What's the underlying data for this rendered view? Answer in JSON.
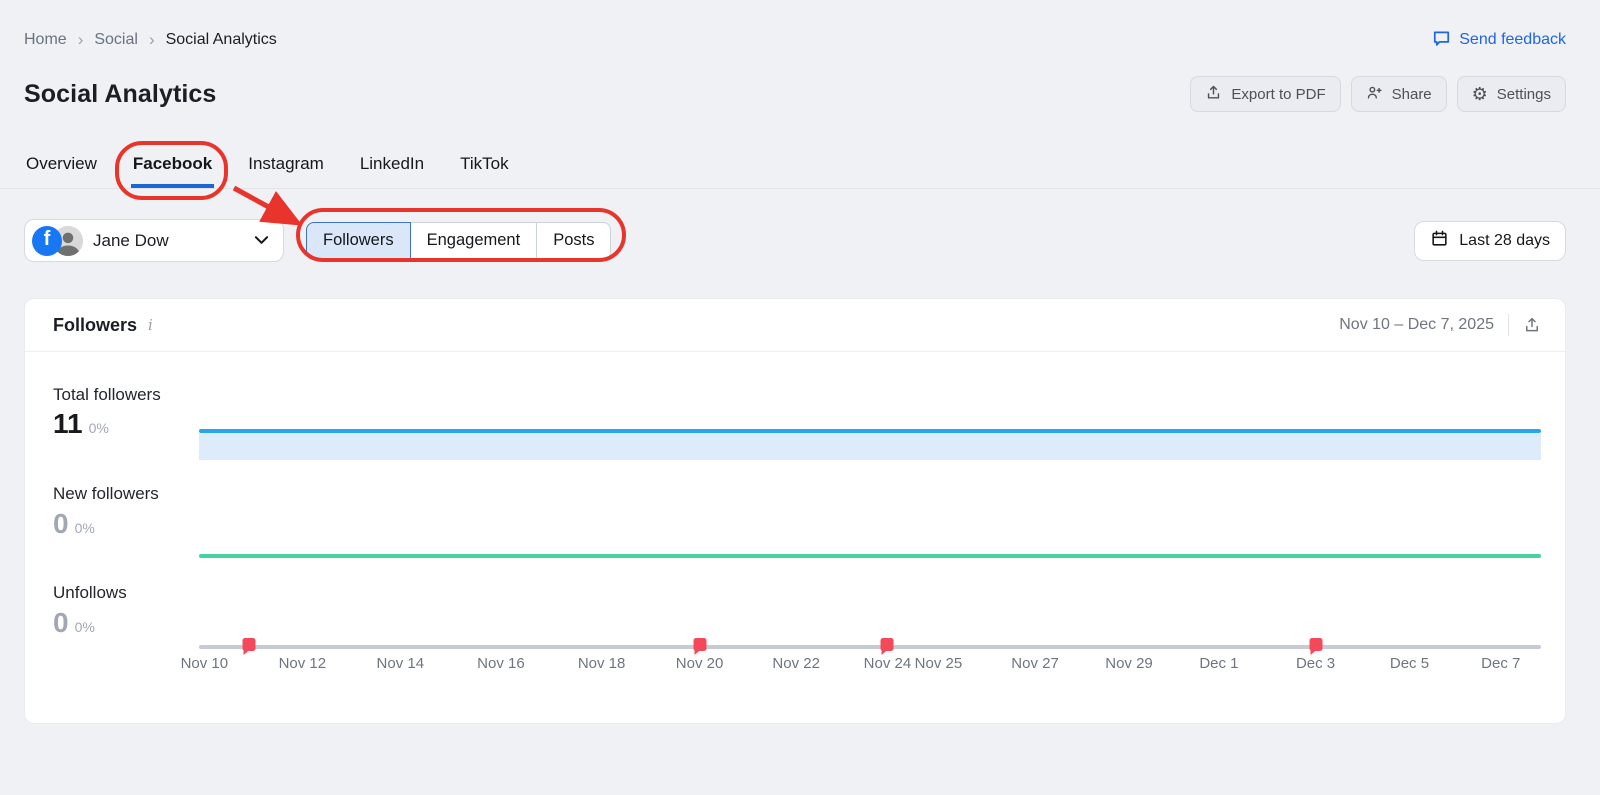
{
  "colors": {
    "accent_blue": "#2166e0",
    "tab_underline": "#1b66d2",
    "chart_blue": "#29a5e9",
    "chart_blue_fill": "#dcecfb",
    "chart_green": "#47d3a0",
    "chart_axis_gray": "#c7cad3",
    "marker_red": "#f4495a",
    "annotation_red": "#e8342b",
    "facebook_blue": "#1877f2",
    "page_background": "#eff1f5"
  },
  "breadcrumb": {
    "home": "Home",
    "social": "Social",
    "current": "Social Analytics",
    "separator": "›"
  },
  "feedback": {
    "label": "Send feedback"
  },
  "header": {
    "title": "Social Analytics",
    "export_pdf": "Export to PDF",
    "share": "Share",
    "settings": "Settings"
  },
  "tabs": [
    {
      "label": "Overview",
      "active": false
    },
    {
      "label": "Facebook",
      "active": true
    },
    {
      "label": "Instagram",
      "active": false
    },
    {
      "label": "LinkedIn",
      "active": false
    },
    {
      "label": "TikTok",
      "active": false
    }
  ],
  "profile_selector": {
    "name": "Jane Dow",
    "network": "Facebook",
    "fb_letter": "f"
  },
  "metric_switcher": [
    {
      "label": "Followers",
      "active": true
    },
    {
      "label": "Engagement",
      "active": false
    },
    {
      "label": "Posts",
      "active": false
    }
  ],
  "date_filter": {
    "label": "Last 28 days"
  },
  "card": {
    "title": "Followers",
    "date_range": "Nov 10 – Dec 7, 2025"
  },
  "icons": {
    "gear": "⚙",
    "info": "i"
  },
  "chart_data": {
    "type": "line",
    "title": "Followers",
    "date_range": "Nov 10 – Dec 7, 2025",
    "x_labels": [
      "Nov 10",
      "Nov 12",
      "Nov 14",
      "Nov 16",
      "Nov 18",
      "Nov 20",
      "Nov 22",
      "Nov 24",
      "Nov 25",
      "Nov 27",
      "Nov 29",
      "Dec 1",
      "Dec 3",
      "Dec 5",
      "Dec 7"
    ],
    "series": [
      {
        "name": "Total followers",
        "current_value": 11,
        "change": "0%",
        "color": "#29a5e9",
        "constant_value": 11
      },
      {
        "name": "New followers",
        "current_value": 0,
        "change": "0%",
        "color": "#47d3a0",
        "constant_value": 0
      },
      {
        "name": "Unfollows",
        "current_value": 0,
        "change": "0%",
        "color": "#c7cad3",
        "constant_value": 0
      }
    ],
    "post_markers": [
      "Nov 11",
      "Nov 20",
      "Nov 24",
      "Dec 3"
    ],
    "grid": false,
    "legend_position": "left"
  }
}
